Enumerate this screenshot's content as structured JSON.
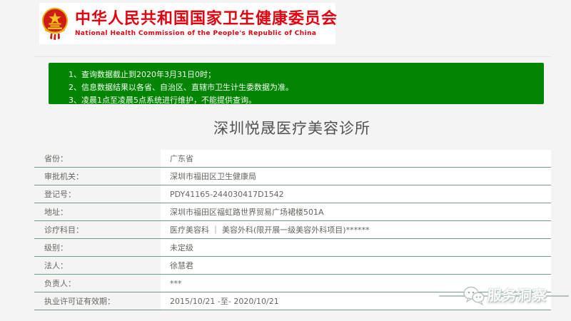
{
  "colors": {
    "brand_red": "#e3000f",
    "notice_green": "#048404",
    "row_separator": "#6f9e90"
  },
  "header": {
    "emblem_icon": "prc-national-emblem",
    "title_zh": "中华人民共和国国家卫生健康委员会",
    "title_en": "National Health Commission of the People's Republic of China"
  },
  "notice": {
    "lines": [
      "1、查询数据截止到2020年3月31日0时；",
      "2、信息数据结果以各省、自治区、直辖市卫生计生委数据为准。",
      "3、凌晨1点至凌晨5点系统进行维护，不能提供查询。"
    ]
  },
  "page_title": "深圳悦晟医疗美容诊所",
  "details": {
    "rows": [
      {
        "label": "省份：",
        "value": "广东省"
      },
      {
        "label": "审批机关：",
        "value": "深圳市福田区卫生健康局"
      },
      {
        "label": "登记号：",
        "value": "PDY41165-244030417D1542"
      },
      {
        "label": "地址：",
        "value": "深圳市福田区福虹路世界贸易广场裙楼501A"
      },
      {
        "label": "诊疗科目：",
        "value": "医疗美容科 ｜ 美容外科(限开展一级美容外科项目)******"
      },
      {
        "label": "级别：",
        "value": "未定级"
      },
      {
        "label": "法人：",
        "value": "徐慧君"
      },
      {
        "label": "负责人：",
        "value": "***"
      },
      {
        "label": "执业许可证有效期：",
        "value": "2015/10/21 -至- 2020/10/21"
      }
    ]
  },
  "watermark": {
    "icon": "chat-bubbles-icon",
    "text": "服务洞察"
  }
}
